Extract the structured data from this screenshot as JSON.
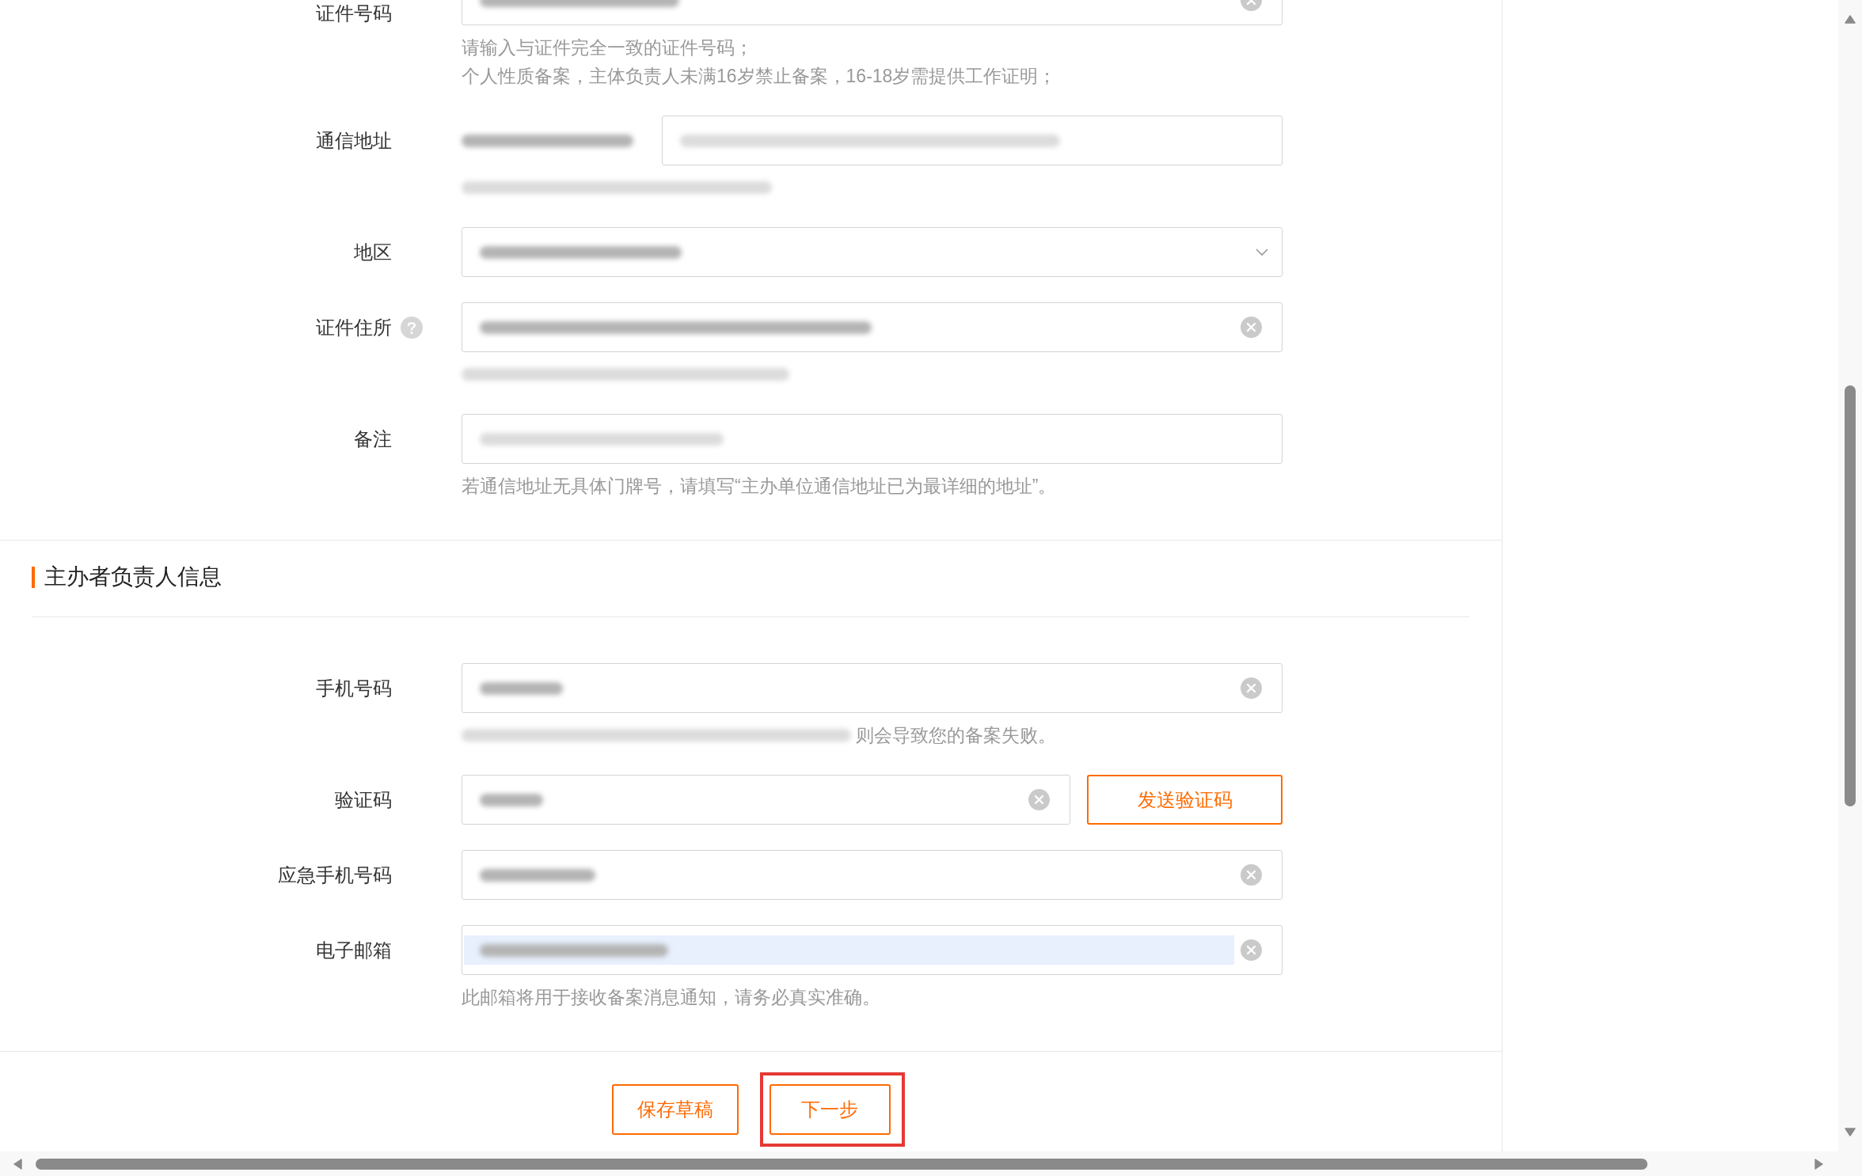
{
  "address_info": {
    "fields": [
      {
        "kind": "input",
        "label": "证件号码",
        "help": false,
        "value_redacted": true,
        "placeholder_redacted": false,
        "clearable": true,
        "autofilled": false,
        "hints": [
          {
            "redacted": false,
            "text": "请输入与证件完全一致的证件号码；"
          },
          {
            "redacted": false,
            "text": "个人性质备案，主体负责人未满16岁禁止备案，16-18岁需提供工作证明；"
          }
        ]
      },
      {
        "kind": "address",
        "label": "通信地址",
        "help": false,
        "value_redacted": true,
        "placeholder_redacted": true,
        "clearable": false,
        "autofilled": false,
        "hints": [
          {
            "redacted": true
          }
        ]
      },
      {
        "kind": "select",
        "label": "地区",
        "help": false,
        "value_redacted": true,
        "placeholder_redacted": false,
        "clearable": false,
        "autofilled": false
      },
      {
        "kind": "input",
        "label": "证件住所",
        "help": true,
        "value_redacted": true,
        "placeholder_redacted": false,
        "clearable": true,
        "autofilled": false,
        "hints": [
          {
            "redacted": true
          }
        ]
      },
      {
        "kind": "input",
        "label": "备注",
        "help": false,
        "value_redacted": false,
        "placeholder_redacted": true,
        "clearable": false,
        "autofilled": false,
        "hints": [
          {
            "redacted": false,
            "text": "若通信地址无具体门牌号，请填写“主办单位通信地址已为最详细的地址”。"
          }
        ]
      }
    ]
  },
  "principal_info": {
    "title": "主办者负责人信息",
    "fields": [
      {
        "kind": "input",
        "label": "手机号码",
        "help": false,
        "value_redacted": true,
        "placeholder_redacted": false,
        "clearable": true,
        "autofilled": false,
        "hints": [
          {
            "redacted": true,
            "text": "则会导致您的备案失败。"
          }
        ]
      },
      {
        "kind": "code",
        "label": "验证码",
        "help": false,
        "value_redacted": true,
        "placeholder_redacted": false,
        "clearable": true,
        "autofilled": false,
        "button": "发送验证码"
      },
      {
        "kind": "input",
        "label": "应急手机号码",
        "help": false,
        "value_redacted": true,
        "placeholder_redacted": false,
        "clearable": true,
        "autofilled": false
      },
      {
        "kind": "input",
        "label": "电子邮箱",
        "help": false,
        "value_redacted": true,
        "placeholder_redacted": false,
        "clearable": true,
        "autofilled": true,
        "hints": [
          {
            "redacted": false,
            "text": "此邮箱将用于接收备案消息通知，请务必真实准确。"
          }
        ]
      }
    ]
  },
  "actions": [
    {
      "label": "保存草稿",
      "highlighted": false
    },
    {
      "label": "下一步",
      "highlighted": true
    }
  ]
}
